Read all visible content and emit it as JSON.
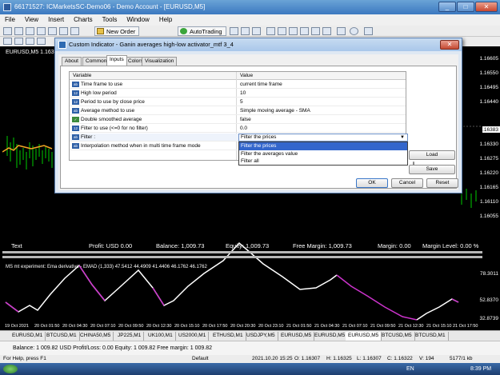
{
  "window": {
    "title": "66171527: ICMarketsSC-Demo06 - Demo Account - [EURUSD,M5]",
    "controls": [
      "_",
      "□",
      "✕"
    ]
  },
  "menu": [
    "File",
    "View",
    "Insert",
    "Charts",
    "Tools",
    "Window",
    "Help"
  ],
  "toolbar": {
    "new_order": "New Order",
    "autotrading": "AutoTrading"
  },
  "chart": {
    "symbol_label": "EURUSD,M5  1.16383",
    "price_labels": [
      "1.16605",
      "1.16550",
      "1.16495",
      "1.16440",
      "1.16383",
      "1.16330",
      "1.16275",
      "1.16220",
      "1.16165",
      "1.16110",
      "1.16055"
    ],
    "account": {
      "text": "Text",
      "profit": "Profit: USD 0.00",
      "balance": "Balance: 1,009.73",
      "equity": "Equity: 1,009.73",
      "free_margin": "Free Margin: 1,009.73",
      "margin": "Margin: 0.00",
      "margin_level": "Margin Level: 0.00 %"
    },
    "subchart_label": "MS mt experiment: Ema derivative - EMAD (1,333) 47.5412 44.4909 41.4406 46.1762 46.1762",
    "sub_prices": [
      "78.3011",
      "52.8370",
      "32.8739"
    ],
    "dates": [
      "19 Oct 2021",
      "20 Oct 01:50",
      "20 Oct 04:30",
      "20 Oct 07:10",
      "20 Oct 09:50",
      "20 Oct 12:30",
      "20 Oct 15:10",
      "20 Oct 17:50",
      "20 Oct 20:30",
      "20 Oct 23:10",
      "21 Oct 01:50",
      "21 Oct 04:30",
      "21 Oct 07:10",
      "21 Oct 09:50",
      "21 Oct 12:30",
      "21 Oct 15:10",
      "21 Oct 17:50"
    ]
  },
  "symbol_tabs": [
    "EURUSD,M1",
    "BTCUSD,M1",
    "CHINA50,M5",
    "JP225,M1",
    "UK100,M1",
    "US2000,M1",
    "ETHUSD,M1",
    "USDJPY,M5",
    "EURUSD,M5",
    "EURUSD,M5",
    "EURUSD,M5",
    "BTCUSD,M5",
    "BTCUSD,M1"
  ],
  "balance_line": "Balance: 1 009.82 USD  Profit/Loss: 0.00  Equity: 1 009.82  Free margin: 1 009.82",
  "statusbar": {
    "help": "For Help, press F1",
    "profile": "Default",
    "datetime": "2021.10.20 15:25",
    "open": "O: 1.16307",
    "high": "H: 1.16325",
    "low": "L: 1.16307",
    "close": "C: 1.16322",
    "volume": "V: 194",
    "traffic": "5177/1 kb"
  },
  "taskbar": {
    "lang": "EN",
    "time": "8:39 PM"
  },
  "dialog": {
    "title": "Custom Indicator - Ganin averages high-low activator_mtf 3_4",
    "close": "✕",
    "tabs": [
      "About",
      "Common",
      "Inputs",
      "Colors",
      "Visualization"
    ],
    "active_tab": "Inputs",
    "columns": {
      "variable": "Variable",
      "value": "Value"
    },
    "params": [
      {
        "icon": "abl",
        "name": "Time frame to use",
        "value": "current time frame"
      },
      {
        "icon": "123",
        "name": "High low period",
        "value": "10"
      },
      {
        "icon": "123",
        "name": "Period to use by close price",
        "value": "5"
      },
      {
        "icon": "abl",
        "name": "Average method to use",
        "value": "Simple moving average - SMA"
      },
      {
        "icon": "bool",
        "name": "Double smoothed average",
        "value": "false"
      },
      {
        "icon": "123",
        "name": "Filter to use (<=0 for no filter)",
        "value": "0.0"
      },
      {
        "icon": "abl",
        "name": "Filter :",
        "value": ""
      },
      {
        "icon": "abl",
        "name": "Interpolation method when in multi time frame mode",
        "value": ""
      }
    ],
    "dropdown": {
      "selected": "Filter the prices",
      "options": [
        "Filter the prices",
        "Filter the averages value",
        "Filter all"
      ]
    },
    "buttons": {
      "load": "Load",
      "save": "Save",
      "ok": "OK",
      "cancel": "Cancel",
      "reset": "Reset"
    }
  }
}
